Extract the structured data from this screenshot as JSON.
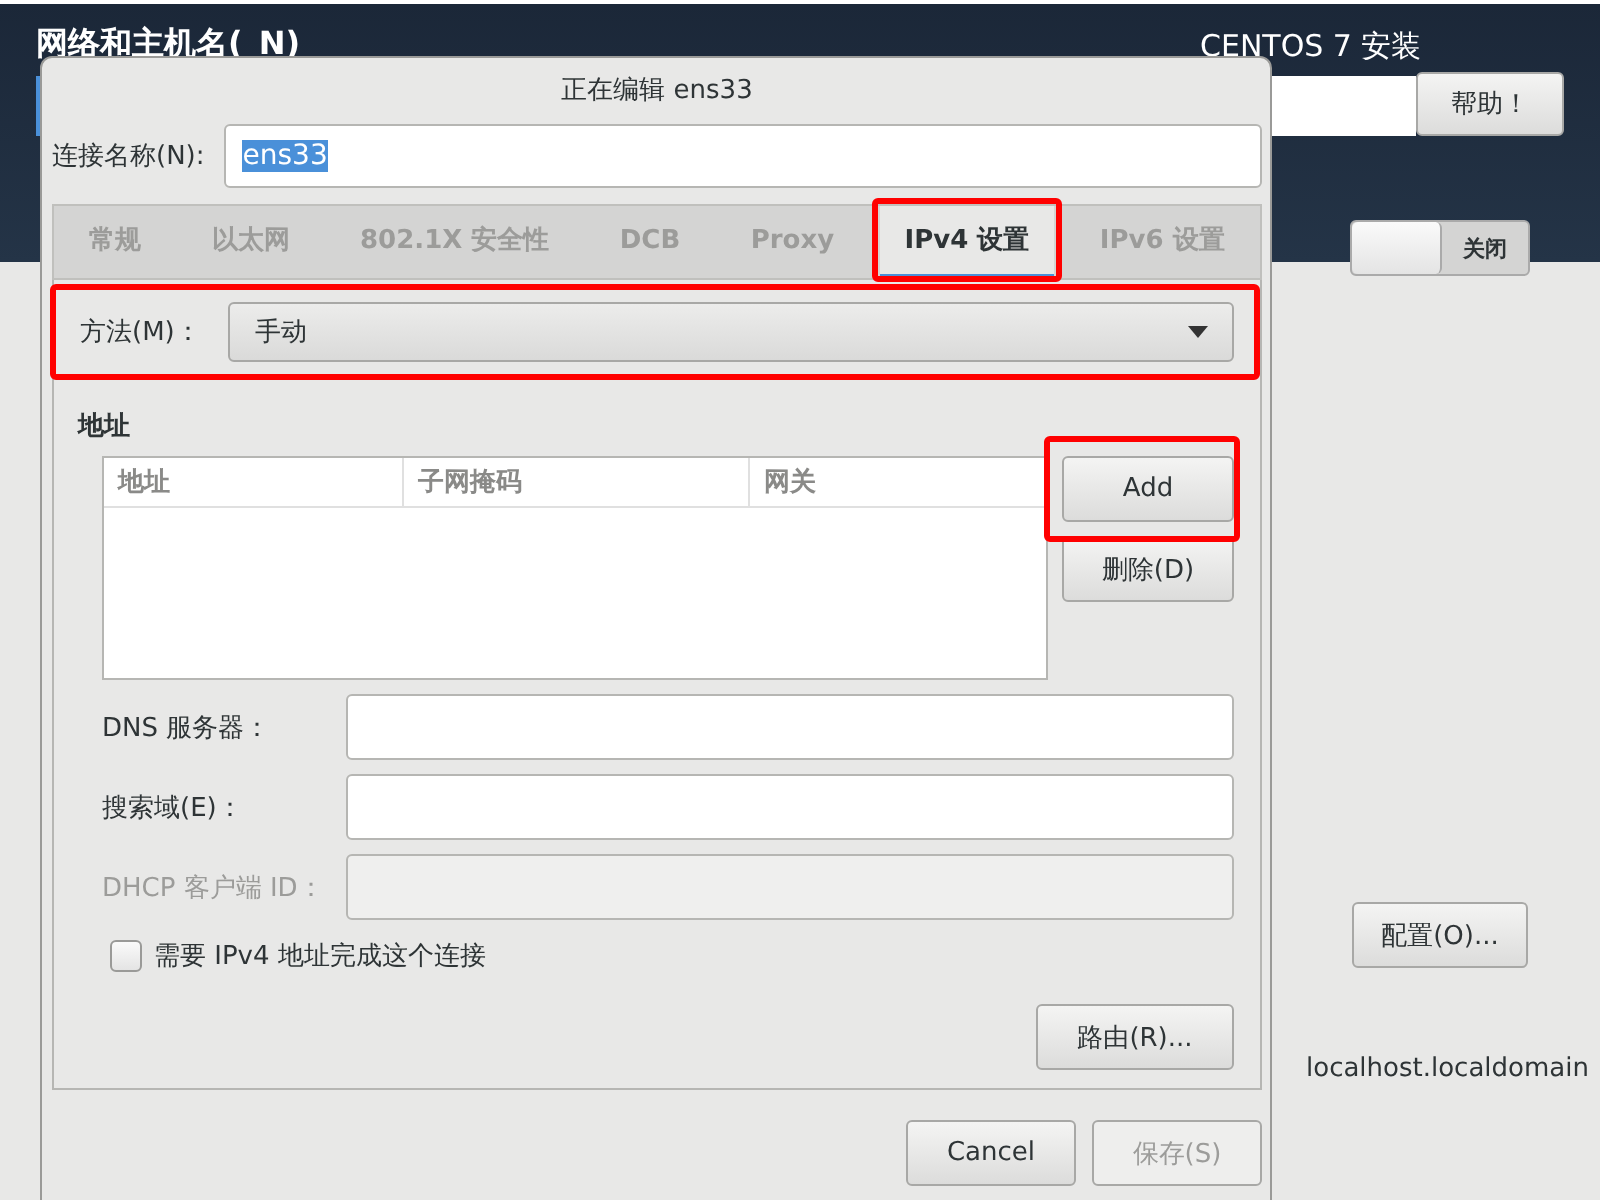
{
  "background": {
    "title": "网络和主机名(_N)",
    "product": "CENTOS 7 安装",
    "help_button": "帮助！",
    "switch": {
      "label": "关闭",
      "on": false
    },
    "configure_button": "配置(O)...",
    "hostname": "localhost.localdomain"
  },
  "dialog": {
    "title": "正在编辑 ens33",
    "connection_name": {
      "label": "连接名称(N):",
      "value": "ens33",
      "text_selected": true
    },
    "tabs": [
      {
        "label": "常规",
        "selected": false,
        "highlighted": false
      },
      {
        "label": "以太网",
        "selected": false,
        "highlighted": false
      },
      {
        "label": "802.1X 安全性",
        "selected": false,
        "highlighted": false
      },
      {
        "label": "DCB",
        "selected": false,
        "highlighted": false
      },
      {
        "label": "Proxy",
        "selected": false,
        "highlighted": false
      },
      {
        "label": "IPv4 设置",
        "selected": true,
        "highlighted": true
      },
      {
        "label": "IPv6 设置",
        "selected": false,
        "highlighted": false
      }
    ],
    "method": {
      "label": "方法(M)：",
      "value": "手动",
      "highlighted": true
    },
    "addresses": {
      "heading": "地址",
      "columns": [
        "地址",
        "子网掩码",
        "网关"
      ],
      "add_button": {
        "label": "Add",
        "highlighted": true
      },
      "delete_button": "删除(D)"
    },
    "fields": [
      {
        "label": "DNS 服务器：",
        "disabled": false
      },
      {
        "label": "搜索域(E)：",
        "disabled": false
      },
      {
        "label": "DHCP 客户端 ID：",
        "disabled": true
      }
    ],
    "require_ipv4": {
      "label": "需要 IPv4 地址完成这个连接",
      "checked": false
    },
    "routes_button": "路由(R)...",
    "buttons": [
      {
        "label": "Cancel",
        "disabled": false
      },
      {
        "label": "保存(S)",
        "disabled": true
      }
    ]
  }
}
